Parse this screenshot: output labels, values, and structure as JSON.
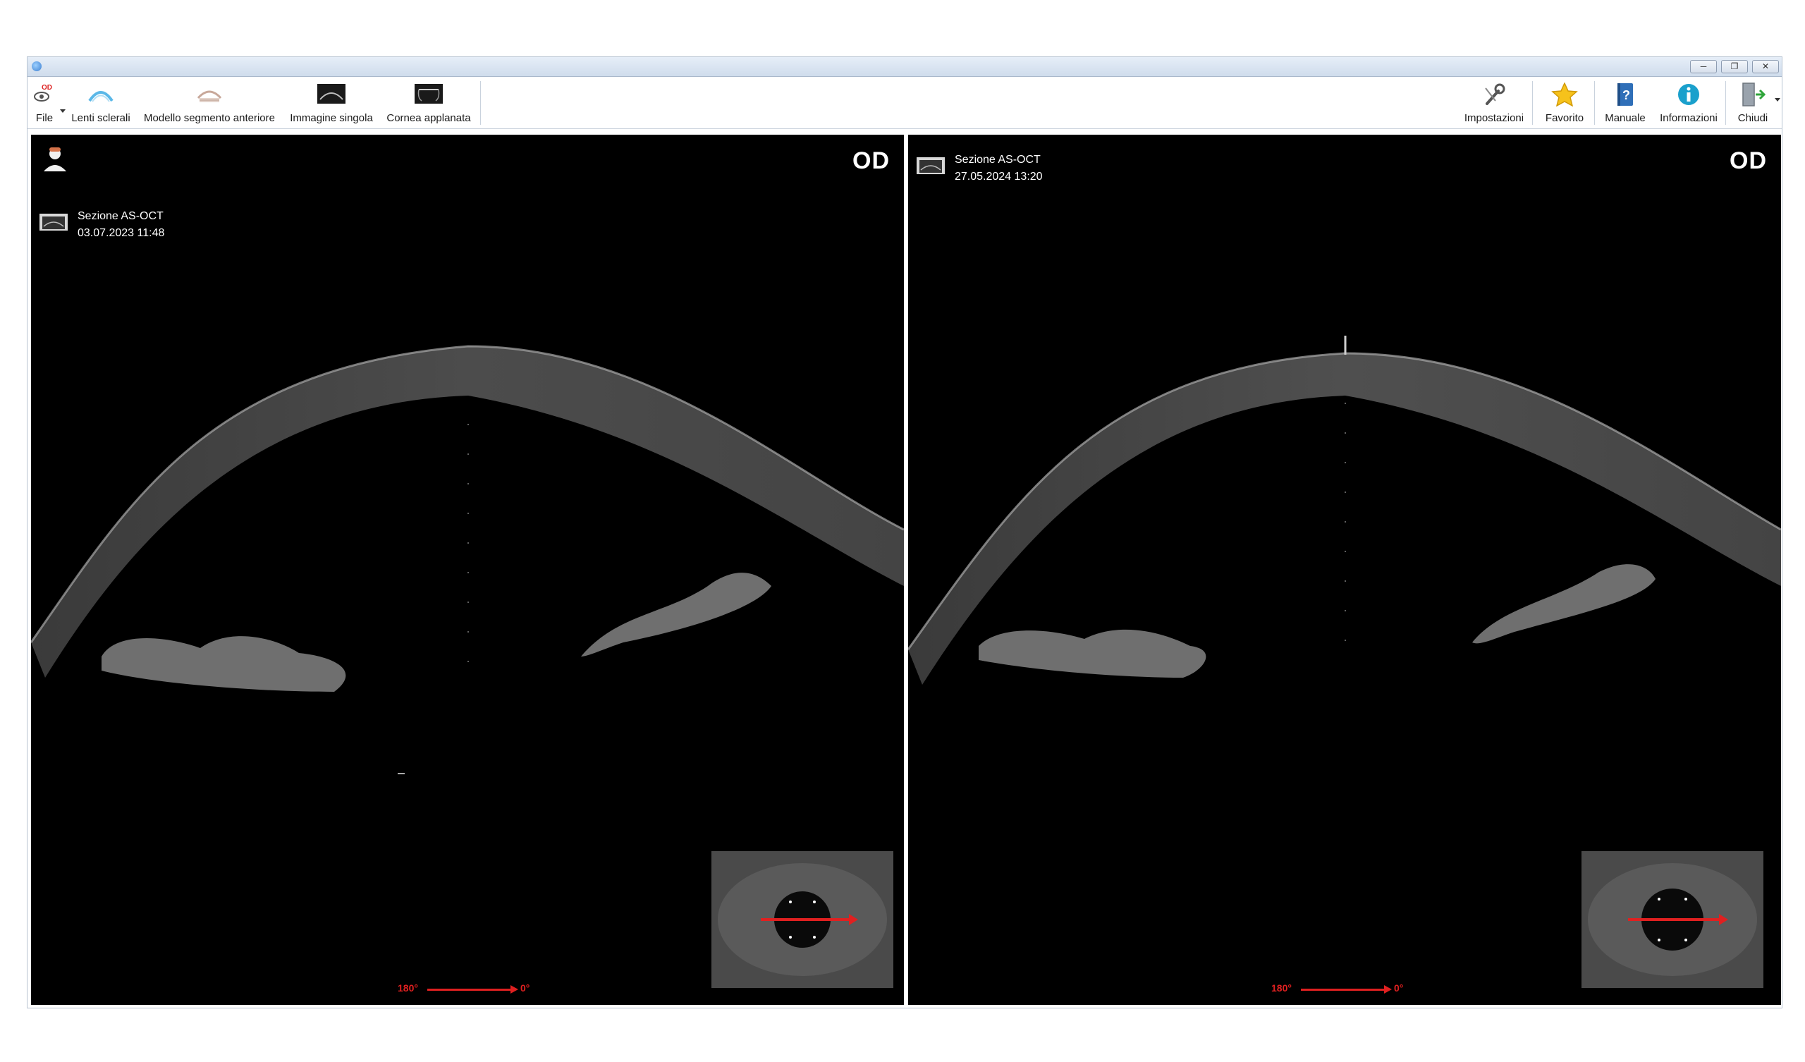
{
  "toolbar": {
    "left_items": [
      {
        "label": "File",
        "icon": "eye-file-icon"
      },
      {
        "label": "Lenti sclerali",
        "icon": "scleral-lens-icon"
      },
      {
        "label": "Modello segmento anteriore",
        "icon": "anterior-segment-model-icon"
      },
      {
        "label": "Immagine singola",
        "icon": "single-image-icon"
      },
      {
        "label": "Cornea applanata",
        "icon": "applanated-cornea-icon"
      }
    ],
    "right_items": [
      {
        "label": "Impostazioni",
        "icon": "wrench-icon"
      },
      {
        "label": "Favorito",
        "icon": "star-icon"
      },
      {
        "label": "Manuale",
        "icon": "manual-icon"
      },
      {
        "label": "Informazioni",
        "icon": "info-icon"
      },
      {
        "label": "Chiudi",
        "icon": "exit-door-icon"
      }
    ]
  },
  "panels": [
    {
      "eye": "OD",
      "scan_type": "Sezione AS-OCT",
      "datetime": "03.07.2023 11:48",
      "direction_start": "180°",
      "direction_end": "0°"
    },
    {
      "eye": "OD",
      "scan_type": "Sezione AS-OCT",
      "datetime": "27.05.2024 13:20",
      "direction_start": "180°",
      "direction_end": "0°"
    }
  ],
  "colors": {
    "panel_bg": "#000000",
    "scan_text": "#ffffff",
    "direction_arrow": "#e02020",
    "toolbar_bg": "#ffffff"
  }
}
